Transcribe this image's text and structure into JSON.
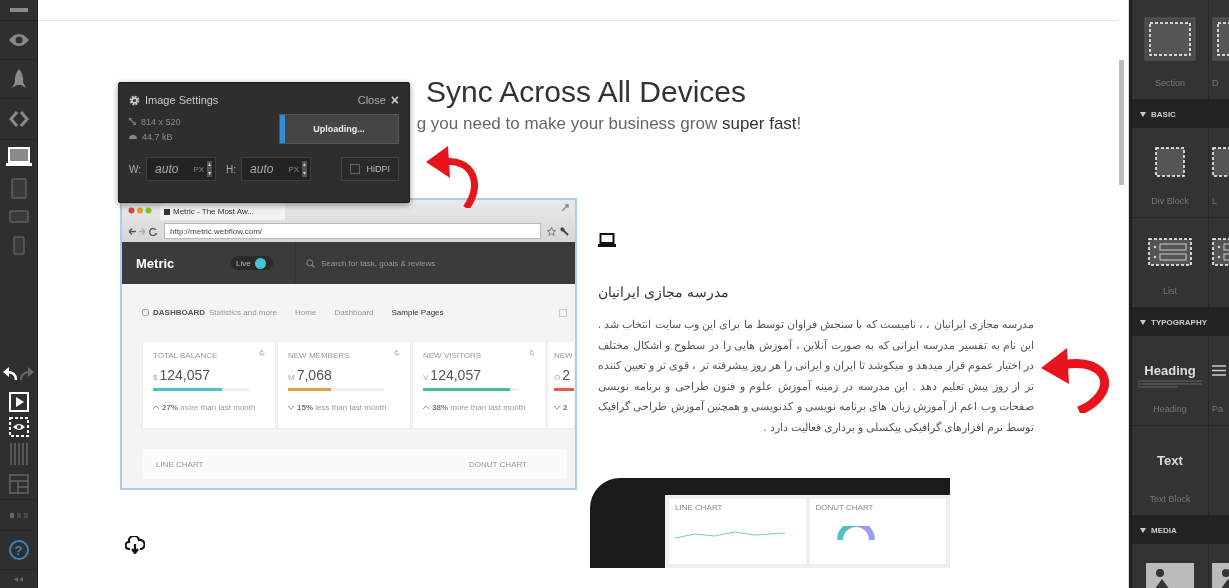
{
  "toolbar": {
    "devices": [
      {
        "kind": "desktop",
        "selected": true
      },
      {
        "kind": "tablet",
        "selected": false
      },
      {
        "kind": "landscape",
        "selected": false
      },
      {
        "kind": "portrait",
        "selected": false
      }
    ],
    "help": "?"
  },
  "canvas": {
    "heading": "Sync Across All Devices",
    "subheading": "g you need to make your business grow **super fast**!",
    "image_settings": {
      "title": "Image Settings",
      "close": "Close",
      "close_icon": "×",
      "dimensions": "814 x 520",
      "file_size": "44.7 kB",
      "upload": {
        "label": "Uploading...",
        "level": 0.04
      },
      "width": {
        "label": "W:",
        "value": "auto",
        "unit": "PX"
      },
      "height": {
        "label": "H:",
        "value": "auto",
        "unit": "PX"
      },
      "hidpi": {
        "label": "HiDPI",
        "checked": false
      }
    },
    "screenshot": {
      "tab": "Metric - The Most Aw...",
      "url": "http://metric.webflow.com/",
      "brand": "Metric",
      "toggle": {
        "label": "Live",
        "on": true
      },
      "search_placeholder": "Search for task, goals & reviews",
      "page_title": "DASHBOARD",
      "page_subtitle": "Statistics and more",
      "breadcrumbs": [
        {
          "label": "Home",
          "selected": false
        },
        {
          "label": "Dashboard",
          "selected": false
        },
        {
          "label": "Sample Pages",
          "selected": true
        }
      ],
      "cards": [
        {
          "title": "TOTAL BALANCE",
          "prefix": "$",
          "value": "124,057",
          "level": 0.72,
          "color": "#4fc1c4",
          "kind": "up",
          "change": "27%",
          "note": "more than last month"
        },
        {
          "title": "NEW MEMBERS",
          "prefix": "M",
          "value": "7,068",
          "level": 0.45,
          "color": "#e59c45",
          "kind": "down",
          "change": "15%",
          "note": "less than last month"
        },
        {
          "title": "NEW VISITORS",
          "prefix": "V",
          "value": "124,057",
          "level": 0.91,
          "color": "#45bf8d",
          "kind": "up",
          "change": "38%",
          "note": "more than last month"
        },
        {
          "title": "NEW",
          "prefix": "O",
          "value": "2",
          "level": 1,
          "color": "#e05a4f",
          "kind": "down",
          "change": "2"
        }
      ],
      "sections": [
        "LINE CHART",
        "DONUT CHART"
      ]
    },
    "feature": {
      "title": "مدرسه مجازی ایرانیان",
      "body": "مدرسه مجازی ایرانیان ، ، نامیست که با سنجش فراوان توسط ما برای این وب سایت انتخاب شد . این نام به تفسیر مدرسه ایرانی که به صورت آنلاین ، آموزش هایی را در سطوح و اشکال مختلف در اختیار عموم قرار میدهد و میکوشد تا ایران و ایرانی را هر روز پیشرفته تر ، قوی تر و تعیین کننده تر از روز پیش تعلیم دهد . این مدرسه در زمینه آموزش علوم و فنون طراحی و برنامه نویسی صفحات وب اعم از آموزش زبان های برنامه نویسی و کدنویسی و همچنین آموزش طراحی گرافیک توسط نرم افزارهای گرافیکی پیکسلی و برداری فعالیت دارد ."
    },
    "phone_screen": {
      "panels": [
        "LINE CHART",
        "DONUT CHART"
      ]
    }
  },
  "panel": {
    "groups": [
      {
        "tiles": [
          {
            "kind": "section",
            "label": "Section"
          },
          {
            "kind": "section",
            "label": "D"
          }
        ]
      },
      {
        "header": "BASIC",
        "expanded": true,
        "tiles": [
          {
            "kind": "div",
            "label": "Div Block"
          },
          {
            "kind": "div",
            "label": "L"
          },
          {
            "kind": "list",
            "label": "List"
          },
          {
            "kind": "list"
          }
        ]
      },
      {
        "header": "TYPOGRAPHY",
        "expanded": true,
        "tiles": [
          {
            "kind": "heading",
            "sample": "Heading",
            "label": "Heading"
          },
          {
            "kind": "paragraph",
            "label": "Pa"
          },
          {
            "kind": "text",
            "sample": "Text",
            "label": "Text Block"
          },
          {
            "kind": "blank"
          }
        ]
      },
      {
        "header": "MEDIA",
        "expanded": true,
        "tiles": [
          {
            "kind": "image"
          },
          {
            "kind": "image"
          }
        ]
      }
    ]
  }
}
